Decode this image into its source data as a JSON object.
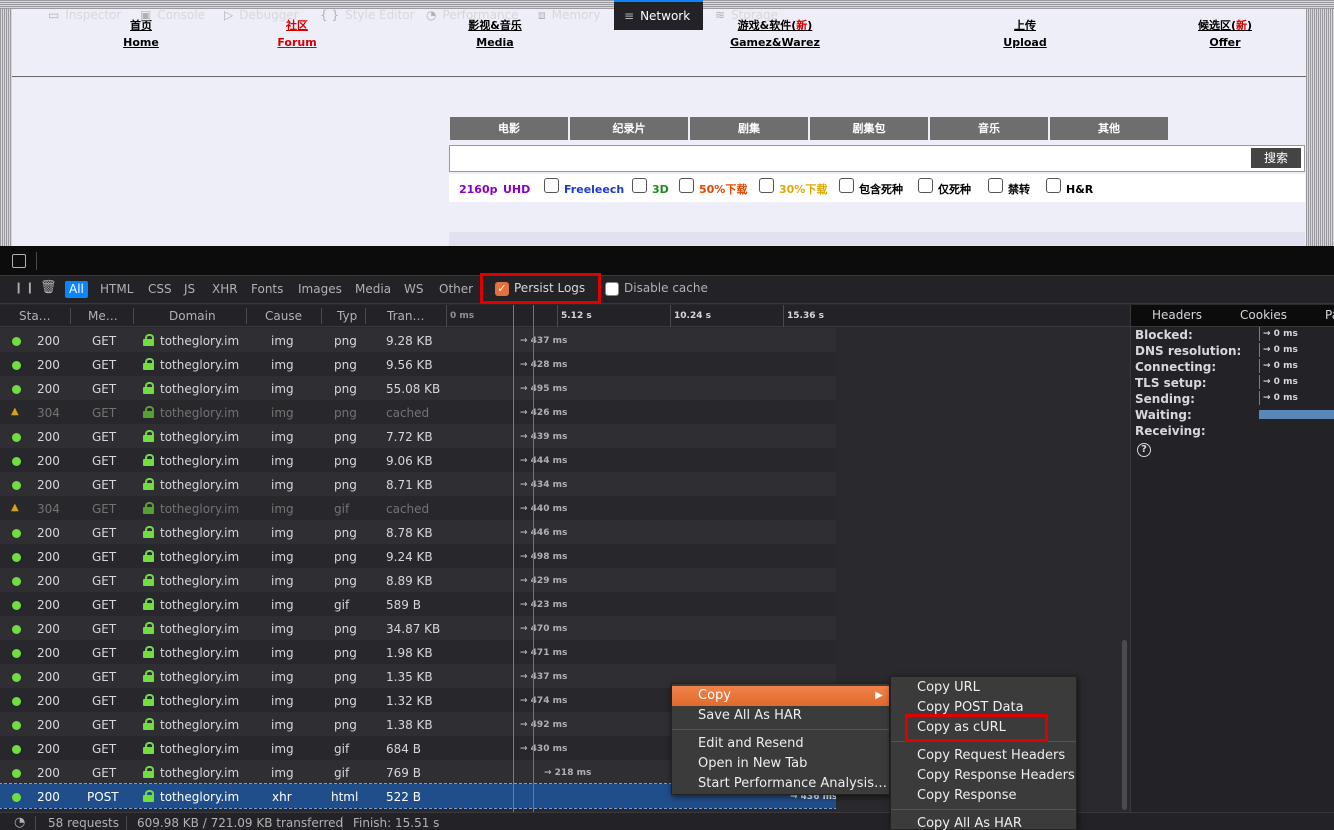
{
  "site": {
    "nav": [
      {
        "zh": "首页",
        "en": "Home",
        "zh_new": "",
        "zh_suffix": "",
        "color": "#000000"
      },
      {
        "zh": "社区",
        "en": "Forum",
        "zh_new": "",
        "zh_suffix": "",
        "color": "#d40000"
      },
      {
        "zh": "影视&音乐",
        "en": "Media",
        "zh_new": "",
        "zh_suffix": "",
        "color": "#000000"
      },
      {
        "zh": "游戏&软件(",
        "en": "Gamez&Warez",
        "zh_new": "新",
        "zh_suffix": ")",
        "color": "#000000"
      },
      {
        "zh": "上传",
        "en": "Upload",
        "zh_new": "",
        "zh_suffix": "",
        "color": "#000000"
      },
      {
        "zh": "候选区(",
        "en": "Offer",
        "zh_new": "新",
        "zh_suffix": ")",
        "color": "#000000"
      }
    ],
    "search_tabs": [
      "电影",
      "纪录片",
      "剧集",
      "剧集包",
      "音乐",
      "其他"
    ],
    "search_button": "搜索",
    "search_value": "",
    "filters": {
      "res_2160p": "2160p",
      "res_uhd": "UHD",
      "freeleech": "Freeleech",
      "threed": "3D",
      "half_dl": "50%下载",
      "thirty_dl": "30%下载",
      "dead": "包含死种",
      "only_dead": "仅死种",
      "banned": "禁转",
      "hnr": "H&R"
    },
    "filter_colors": {
      "res": "#8a00c8",
      "freeleech": "#1a3cc8",
      "threed": "#1e8a1e",
      "half": "#e04a00",
      "thirty": "#e0a800",
      "plain": "#000000"
    }
  },
  "devtools": {
    "tabs": [
      {
        "icon": "inspector-icon",
        "glyph": "▭",
        "label": "Inspector"
      },
      {
        "icon": "console-icon",
        "glyph": "▣",
        "label": "Console"
      },
      {
        "icon": "debugger-icon",
        "glyph": "▷",
        "label": "Debugger"
      },
      {
        "icon": "style-editor-icon",
        "glyph": "{ }",
        "label": "Style Editor"
      },
      {
        "icon": "performance-icon",
        "glyph": "◔",
        "label": "Performance"
      },
      {
        "icon": "memory-icon",
        "glyph": "⧈",
        "label": "Memory"
      },
      {
        "icon": "network-icon",
        "glyph": "≡",
        "label": "Network"
      },
      {
        "icon": "storage-icon",
        "glyph": "≋",
        "label": "Storage"
      }
    ],
    "selected_tab": "Network",
    "filter_buttons": [
      "All",
      "HTML",
      "CSS",
      "JS",
      "XHR",
      "Fonts",
      "Images",
      "Media",
      "WS",
      "Other"
    ],
    "persist_logs_label": "Persist Logs",
    "persist_logs_checked": true,
    "disable_cache_label": "Disable cache",
    "disable_cache_checked": false,
    "columns": [
      "Sta…",
      "Me…",
      "Domain",
      "Cause",
      "Typ",
      "Tran…"
    ],
    "waterfall_ticks": [
      "0 ms",
      "5.12 s",
      "10.24 s",
      "15.36 s"
    ],
    "requests": [
      {
        "status": "200",
        "method": "GET",
        "domain": "totheglory.im",
        "cause": "img",
        "type": "png",
        "transferred": "9.28 KB",
        "time": "→ 437 ms"
      },
      {
        "status": "200",
        "method": "GET",
        "domain": "totheglory.im",
        "cause": "img",
        "type": "png",
        "transferred": "9.56 KB",
        "time": "→ 428 ms"
      },
      {
        "status": "200",
        "method": "GET",
        "domain": "totheglory.im",
        "cause": "img",
        "type": "png",
        "transferred": "55.08 KB",
        "time": "→ 495 ms"
      },
      {
        "status": "304",
        "method": "GET",
        "domain": "totheglory.im",
        "cause": "img",
        "type": "png",
        "transferred": "cached",
        "time": "→ 426 ms"
      },
      {
        "status": "200",
        "method": "GET",
        "domain": "totheglory.im",
        "cause": "img",
        "type": "png",
        "transferred": "7.72 KB",
        "time": "→ 439 ms"
      },
      {
        "status": "200",
        "method": "GET",
        "domain": "totheglory.im",
        "cause": "img",
        "type": "png",
        "transferred": "9.06 KB",
        "time": "→ 444 ms"
      },
      {
        "status": "200",
        "method": "GET",
        "domain": "totheglory.im",
        "cause": "img",
        "type": "png",
        "transferred": "8.71 KB",
        "time": "→ 434 ms"
      },
      {
        "status": "304",
        "method": "GET",
        "domain": "totheglory.im",
        "cause": "img",
        "type": "gif",
        "transferred": "cached",
        "time": "→ 440 ms"
      },
      {
        "status": "200",
        "method": "GET",
        "domain": "totheglory.im",
        "cause": "img",
        "type": "png",
        "transferred": "8.78 KB",
        "time": "→ 446 ms"
      },
      {
        "status": "200",
        "method": "GET",
        "domain": "totheglory.im",
        "cause": "img",
        "type": "png",
        "transferred": "9.24 KB",
        "time": "→ 498 ms"
      },
      {
        "status": "200",
        "method": "GET",
        "domain": "totheglory.im",
        "cause": "img",
        "type": "png",
        "transferred": "8.89 KB",
        "time": "→ 429 ms"
      },
      {
        "status": "200",
        "method": "GET",
        "domain": "totheglory.im",
        "cause": "img",
        "type": "gif",
        "transferred": "589 B",
        "time": "→ 423 ms"
      },
      {
        "status": "200",
        "method": "GET",
        "domain": "totheglory.im",
        "cause": "img",
        "type": "png",
        "transferred": "34.87 KB",
        "time": "→ 470 ms"
      },
      {
        "status": "200",
        "method": "GET",
        "domain": "totheglory.im",
        "cause": "img",
        "type": "png",
        "transferred": "1.98 KB",
        "time": "→ 471 ms"
      },
      {
        "status": "200",
        "method": "GET",
        "domain": "totheglory.im",
        "cause": "img",
        "type": "png",
        "transferred": "1.35 KB",
        "time": "→ 437 ms"
      },
      {
        "status": "200",
        "method": "GET",
        "domain": "totheglory.im",
        "cause": "img",
        "type": "png",
        "transferred": "1.32 KB",
        "time": "→ 474 ms"
      },
      {
        "status": "200",
        "method": "GET",
        "domain": "totheglory.im",
        "cause": "img",
        "type": "png",
        "transferred": "1.38 KB",
        "time": "→ 492 ms"
      },
      {
        "status": "200",
        "method": "GET",
        "domain": "totheglory.im",
        "cause": "img",
        "type": "gif",
        "transferred": "684 B",
        "time": "→ 430 ms"
      },
      {
        "status": "200",
        "method": "GET",
        "domain": "totheglory.im",
        "cause": "img",
        "type": "gif",
        "transferred": "769 B",
        "time": "→ 218 ms"
      },
      {
        "status": "200",
        "method": "POST",
        "domain": "totheglory.im",
        "cause": "xhr",
        "type": "html",
        "transferred": "522 B",
        "time": "→ 436 ms"
      }
    ],
    "side_tabs": [
      "Headers",
      "Cookies",
      "Pa"
    ],
    "timings": [
      {
        "label": "Blocked:",
        "value": "→ 0 ms"
      },
      {
        "label": "DNS resolution:",
        "value": "→ 0 ms"
      },
      {
        "label": "Connecting:",
        "value": "→ 0 ms"
      },
      {
        "label": "TLS setup:",
        "value": "→ 0 ms"
      },
      {
        "label": "Sending:",
        "value": "→ 0 ms"
      },
      {
        "label": "Waiting:",
        "value": ""
      },
      {
        "label": "Receiving:",
        "value": ""
      }
    ],
    "status": {
      "requests": "58 requests",
      "transferred": "609.98 KB / 721.09 KB transferred",
      "finish": "Finish: 15.51 s"
    }
  },
  "context_menu": {
    "items": [
      "Copy",
      "Save All As HAR",
      "Edit and Resend",
      "Open in New Tab",
      "Start Performance Analysis…"
    ],
    "highlighted": "Copy",
    "submenu": [
      "Copy URL",
      "Copy POST Data",
      "Copy as cURL",
      "Copy Request Headers",
      "Copy Response Headers",
      "Copy Response",
      "Copy All As HAR"
    ],
    "submenu_highlighted": "Copy as cURL"
  },
  "colors": {
    "accent": "#0a84ff",
    "status_ok": "#70de3f",
    "status_cached": "#d7a018",
    "menu_highlight": "#e06a2e",
    "annotation_red": "#e00000"
  }
}
